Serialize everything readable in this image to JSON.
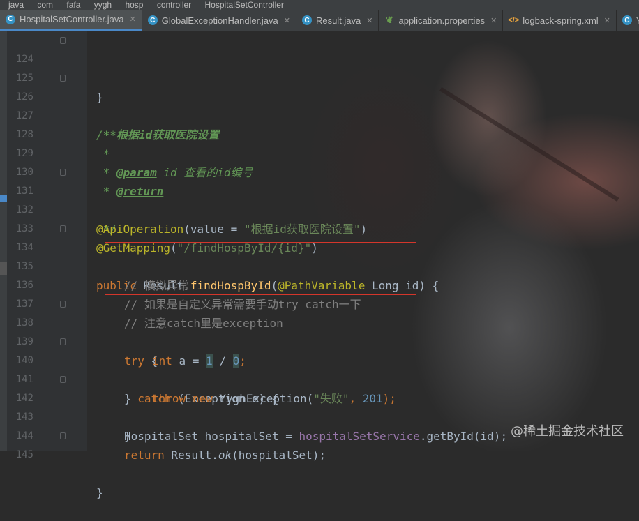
{
  "breadcrumb": [
    "java",
    "com",
    "fafa",
    "yygh",
    "hosp",
    "controller",
    "HospitalSetController"
  ],
  "tabs": [
    {
      "label": "HospitalSetController.java",
      "icon": "java-class-icon",
      "active": true
    },
    {
      "label": "GlobalExceptionHandler.java",
      "icon": "java-class-icon",
      "active": false
    },
    {
      "label": "Result.java",
      "icon": "java-class-icon",
      "active": false
    },
    {
      "label": "application.properties",
      "icon": "spring-leaf-icon",
      "active": false
    },
    {
      "label": "logback-spring.xml",
      "icon": "xml-file-icon",
      "active": false
    },
    {
      "label": "Y",
      "icon": "java-class-icon",
      "active": false
    }
  ],
  "lines": {
    "n124": "124",
    "n125": "125",
    "n126": "126",
    "n127": "127",
    "n128": "128",
    "n129": "129",
    "n130": "130",
    "n131": "131",
    "n132": "132",
    "n133": "133",
    "n134": "134",
    "n135": "135",
    "n136": "136",
    "n137": "137",
    "n138": "138",
    "n139": "139",
    "n140": "140",
    "n141": "141",
    "n142": "142",
    "n143": "143",
    "n144": "144",
    "n145": "145"
  },
  "code": {
    "l124": "}",
    "l126": "/**",
    "l127_star": " * ",
    "l127_text": "根据id获取医院设置",
    "l128": " *",
    "l129_star": " * ",
    "l129_tag": "@param",
    "l129_text": " id 查看的id编号",
    "l130_star": " * ",
    "l130_tag": "@return",
    "l131": " */",
    "l132_ann": "@ApiOperation",
    "l132_p1": "(value = ",
    "l132_str": "\"根据id获取医院设置\"",
    "l132_p2": ")",
    "l133_ann": "@GetMapping",
    "l133_p1": "(",
    "l133_str": "\"/findHospById/{id}\"",
    "l133_p2": ")",
    "l134_kw": "public",
    "l134_p1": " Result ",
    "l134_method": "findHospById",
    "l134_p2": "(",
    "l134_ann": "@PathVariable",
    "l134_p3": " Long id) {",
    "l135": "// 模拟异常",
    "l136": "// 如果是自定义异常需要手动try catch一下",
    "l137": "// 注意catch里是exception",
    "l138_kw": "try",
    "l138_p1": " {",
    "l139_kw": "int",
    "l139_p1": " a = ",
    "l139_n1": "1",
    "l139_p2": " / ",
    "l139_n2": "0",
    "l139_p3": ";",
    "l140_p0": "} ",
    "l140_kw": "catch",
    "l140_p1": " (Exception e) {",
    "l141_kw1": "throw",
    "l141_sp": " ",
    "l141_kw2": "new",
    "l141_p1": " YyghException(",
    "l141_str": "\"失败\"",
    "l141_p2": ", ",
    "l141_num": "201",
    "l141_p3": ");",
    "l142": "}",
    "l143_p1": "HospitalSet hospitalSet = ",
    "l143_fld": "hospitalSetService",
    "l143_p2": ".getById(id);",
    "l144_kw": "return",
    "l144_p1": " Result.",
    "l144_ital": "ok",
    "l144_p2": "(hospitalSet);",
    "l145": "}"
  },
  "watermark": "@稀土掘金技术社区"
}
